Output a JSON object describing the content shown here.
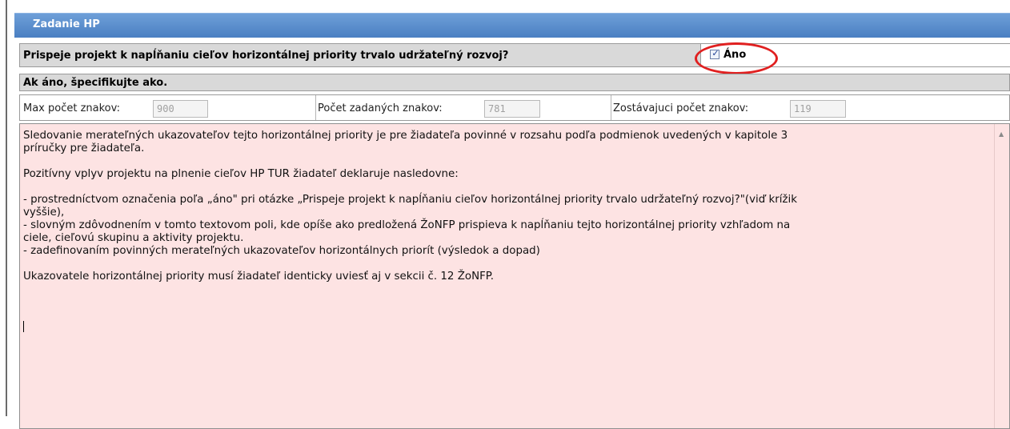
{
  "panel": {
    "title": "Zadanie HP"
  },
  "question": {
    "label": "Prispeje projekt k napĺňaniu cieľov horizontálnej priority trvalo udržateľný rozvoj?",
    "answer_label": "Áno",
    "checked": true
  },
  "specify_label": "Ak áno, špecifikujte ako.",
  "counts": {
    "max_label": "Max počet znakov:",
    "max_value": "900",
    "entered_label": "Počet zadaných znakov:",
    "entered_value": "781",
    "remaining_label": "Zostávajuci počet znakov:",
    "remaining_value": "119"
  },
  "textarea": {
    "paragraphs": [
      [
        "Sledovanie merateľných ukazovateľov tejto horizontálnej priority je pre žiadateľa povinné v rozsahu podľa podmienok uvedených v kapitole 3",
        "príručky pre žiadateľa."
      ],
      [
        "Pozitívny  vplyv projektu na plnenie cieľov HP TUR žiadateľ deklaruje nasledovne:"
      ],
      [
        "- prostredníctvom označenia poľa „áno\" pri otázke „Prispeje projekt k napĺňaniu cieľov horizontálnej priority trvalo udržateľný rozvoj?\"(viď krížik",
        "vyššie),",
        "- slovným zdôvodnením v tomto textovom poli, kde opíše ako predložená ŽoNFP prispieva k napĺňaniu tejto horizontálnej priority vzhľadom na",
        "ciele, cieľovú skupinu a aktivity projektu.",
        "- zadefinovaním povinných merateľných ukazovateľov horizontálnych priorít (výsledok a dopad)"
      ],
      [
        "Ukazovatele horizontálnej priority musí žiadateľ identicky uviesť aj v sekcii č. 12 ŽoNFP."
      ]
    ]
  },
  "colors": {
    "header": "#5a8fd0",
    "textarea_bg": "#fde3e3",
    "highlight_circle": "#e02020"
  },
  "icons": [
    "checkbox-checked-icon",
    "scroll-up-arrow-icon"
  ]
}
